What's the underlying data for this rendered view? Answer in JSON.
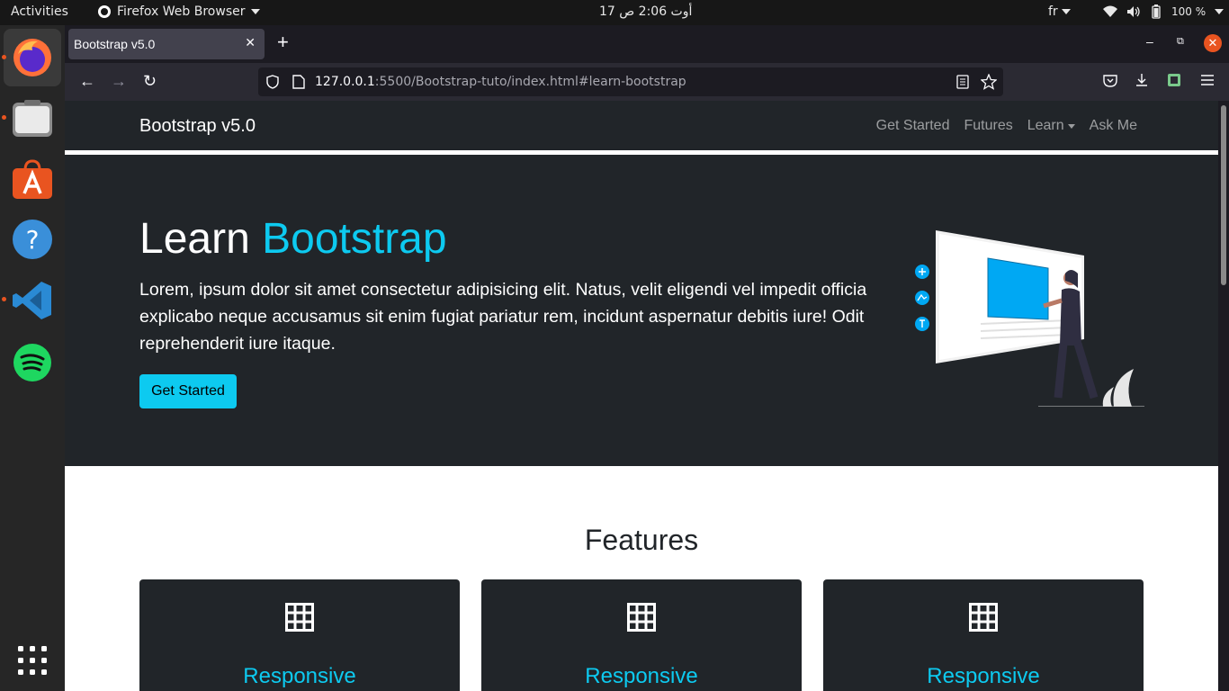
{
  "topbar": {
    "activities": "Activities",
    "app_name": "Firefox Web Browser",
    "clock": "17 أوت  2:06 ص",
    "lang": "fr",
    "battery": "100 %"
  },
  "dock": {
    "items": [
      {
        "name": "Firefox",
        "icon": "firefox-icon"
      },
      {
        "name": "Files",
        "icon": "files-icon"
      },
      {
        "name": "Ubuntu Software",
        "icon": "software-store-icon"
      },
      {
        "name": "Help",
        "icon": "help-icon"
      },
      {
        "name": "Visual Studio Code",
        "icon": "vscode-icon"
      },
      {
        "name": "Spotify",
        "icon": "spotify-icon"
      }
    ],
    "show_apps_icon": "app-grid-icon",
    "accent": "#e95420"
  },
  "browser": {
    "tab_title": "Bootstrap v5.0",
    "url_host": "127.0.0.1",
    "url_rest": ":5500/Bootstrap-tuto/index.html#learn-bootstrap"
  },
  "site": {
    "brand": "Bootstrap v5.0",
    "nav": [
      "Get Started",
      "Futures",
      "Learn",
      "Ask Me"
    ],
    "hero": {
      "title_plain": "Learn ",
      "title_accent": "Bootstrap",
      "text": "Lorem, ipsum dolor sit amet consectetur adipisicing elit. Natus, velit eligendi vel impedit officia explicabo neque accusamus sit enim fugiat pariatur rem, incidunt aspernatur debitis iure! Odit reprehenderit iure itaque.",
      "button": "Get Started"
    },
    "features_title": "Features",
    "cards": [
      {
        "title": "Responsive",
        "icon": "grid-icon"
      },
      {
        "title": "Responsive",
        "icon": "grid-icon"
      },
      {
        "title": "Responsive",
        "icon": "grid-icon"
      }
    ],
    "colors": {
      "dark": "#212529",
      "info": "#0dcaf0"
    }
  }
}
